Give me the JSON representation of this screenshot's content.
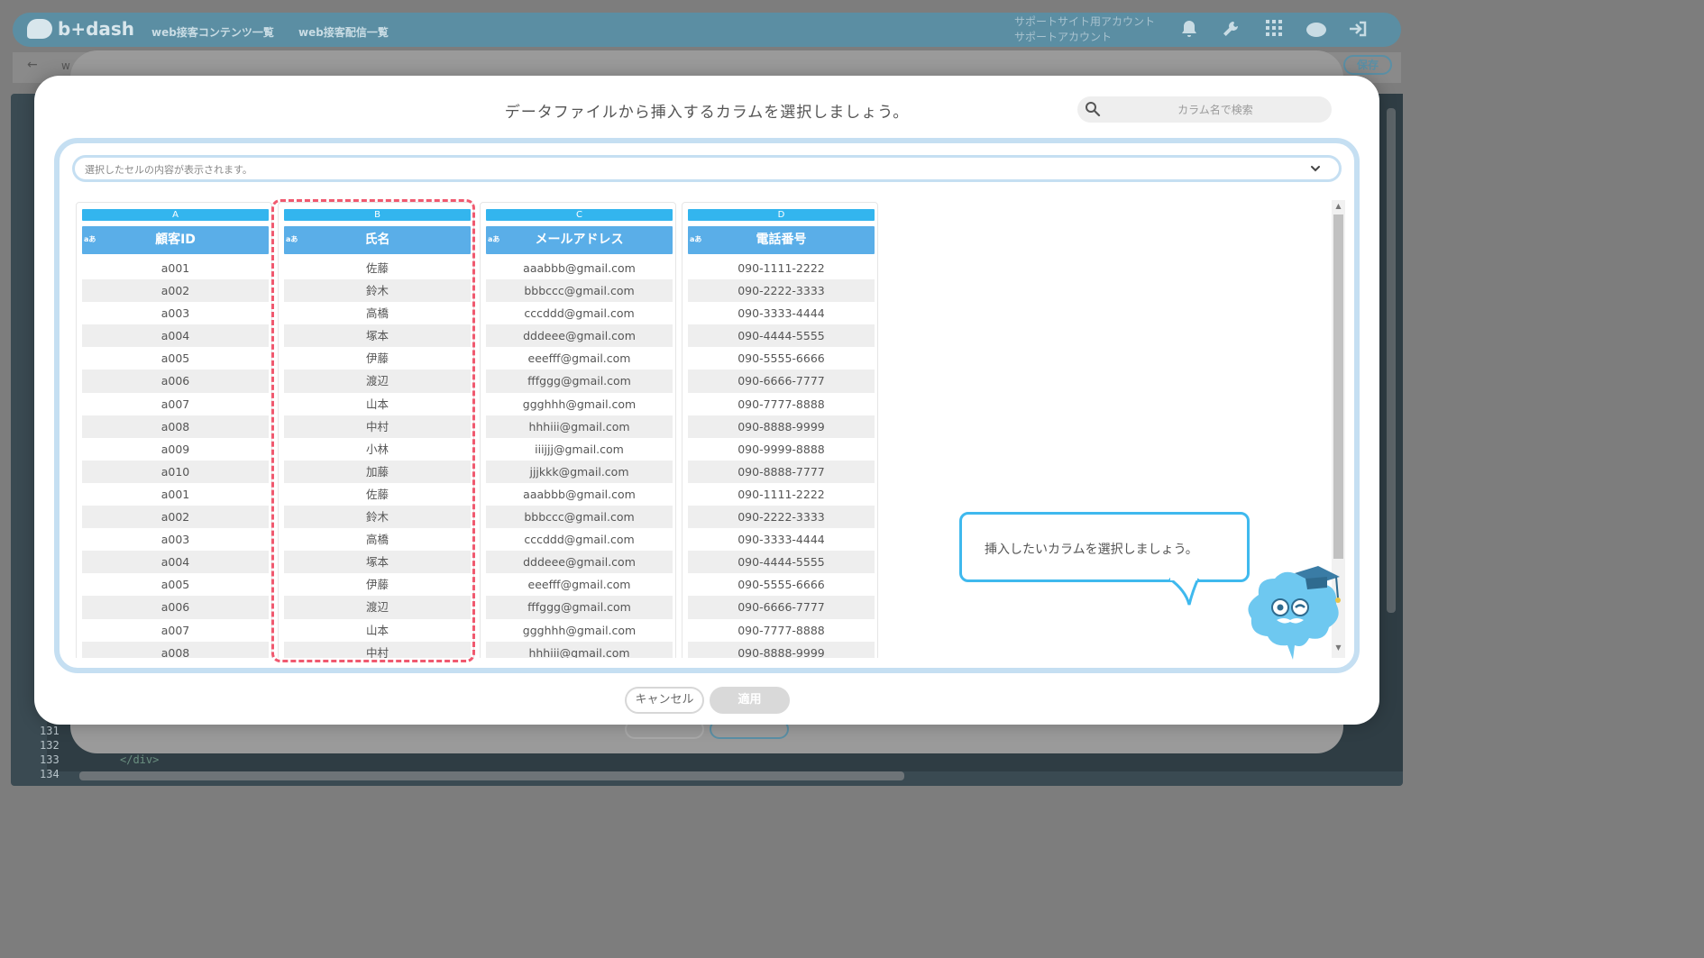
{
  "background": {
    "logo_text": "b+dash",
    "nav": [
      "web接客コンテンツ一覧",
      "web接客配信一覧"
    ],
    "account_line1": "サポートサイト用アカウント",
    "account_line2": "サポートアカウント",
    "back_label": "←",
    "breadcrumb_stub": "w",
    "save_label": "保存",
    "line_numbers": [
      "131",
      "132",
      "133",
      "134"
    ],
    "code_snippet": "</div>",
    "header_icons": [
      "bell-icon",
      "wrench-icon",
      "grid-icon",
      "cloud-icon",
      "logout-icon"
    ]
  },
  "modal": {
    "title": "データファイルから挿入するカラムを選択しましょう。",
    "search_placeholder": "カラム名で検索",
    "cell_display_placeholder": "選択したセルの内容が表示されます。",
    "type_badge": "aあ",
    "columns": [
      {
        "letter": "A",
        "header": "顧客ID",
        "rows": [
          "a001",
          "a002",
          "a003",
          "a004",
          "a005",
          "a006",
          "a007",
          "a008",
          "a009",
          "a010",
          "a001",
          "a002",
          "a003",
          "a004",
          "a005",
          "a006",
          "a007",
          "a008"
        ]
      },
      {
        "letter": "B",
        "header": "氏名",
        "selected": true,
        "rows": [
          "佐藤",
          "鈴木",
          "高橋",
          "塚本",
          "伊藤",
          "渡辺",
          "山本",
          "中村",
          "小林",
          "加藤",
          "佐藤",
          "鈴木",
          "高橋",
          "塚本",
          "伊藤",
          "渡辺",
          "山本",
          "中村"
        ]
      },
      {
        "letter": "C",
        "header": "メールアドレス",
        "rows": [
          "aaabbb@gmail.com",
          "bbbccc@gmail.com",
          "cccddd@gmail.com",
          "dddeee@gmail.com",
          "eeefff@gmail.com",
          "fffggg@gmail.com",
          "ggghhh@gmail.com",
          "hhhiii@gmail.com",
          "iiijjj@gmail.com",
          "jjjkkk@gmail.com",
          "aaabbb@gmail.com",
          "bbbccc@gmail.com",
          "cccddd@gmail.com",
          "dddeee@gmail.com",
          "eeefff@gmail.com",
          "fffggg@gmail.com",
          "ggghhh@gmail.com",
          "hhhiii@gmail.com"
        ]
      },
      {
        "letter": "D",
        "header": "電話番号",
        "rows": [
          "090-1111-2222",
          "090-2222-3333",
          "090-3333-4444",
          "090-4444-5555",
          "090-5555-6666",
          "090-6666-7777",
          "090-7777-8888",
          "090-8888-9999",
          "090-9999-8888",
          "090-8888-7777",
          "090-1111-2222",
          "090-2222-3333",
          "090-3333-4444",
          "090-4444-5555",
          "090-5555-6666",
          "090-6666-7777",
          "090-7777-8888",
          "090-8888-9999"
        ]
      }
    ],
    "tooltip_text": "挿入したいカラムを選択しましょう。",
    "cancel_label": "キャンセル",
    "apply_label": "適用",
    "scroll_up": "▲",
    "scroll_down": "▼"
  },
  "colors": {
    "column_letter_bg": "#33b5ee",
    "column_header_bg": "#5aaee8",
    "selection_outline": "#f0596f",
    "panel_border": "#c5dff2",
    "tooltip_border": "#3fb9ee"
  }
}
